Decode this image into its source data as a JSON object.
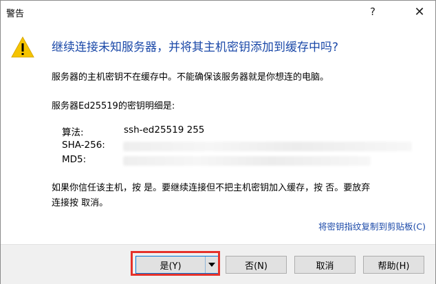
{
  "window": {
    "title": "警告",
    "help_glyph": "?",
    "close_glyph": "✕"
  },
  "icon": "warning-icon",
  "instruction": "继续连接未知服务器，并将其主机密钥添加到缓存中吗?",
  "content": {
    "line1": "服务器的主机密钥不在缓存中。不能确保该服务器就是你想连的电脑。",
    "line2": "服务器Ed25519的密钥明细是:",
    "rows": [
      {
        "label": "算法:",
        "value": "ssh-ed25519 255"
      },
      {
        "label": "SHA-256:",
        "value": ""
      },
      {
        "label": "MD5:",
        "value": ""
      }
    ],
    "para_line1": "如果你信任该主机，按 是。要继续连接但不把主机密钥加入缓存，按 否。要放弃",
    "para_line2": "连接按 取消。"
  },
  "copy_link": "将密钥指纹复制到剪贴板(C)",
  "buttons": {
    "yes": "是(Y)",
    "no": "否(N)",
    "cancel": "取消",
    "help": "帮助(H)"
  },
  "colors": {
    "instruction": "#1a48a8",
    "highlight": "#e5312a",
    "warning": "#f5c400"
  }
}
